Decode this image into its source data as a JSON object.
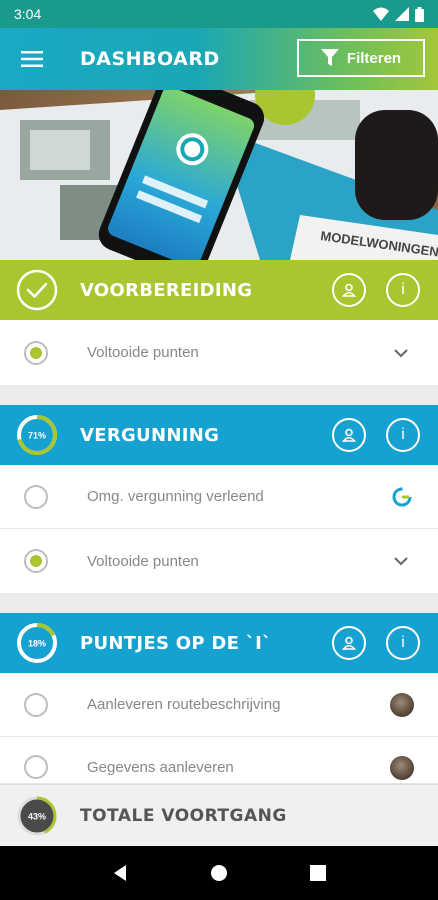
{
  "status": {
    "time": "3:04"
  },
  "appbar": {
    "title": "DASHBOARD",
    "filter_label": "Filteren"
  },
  "hero": {
    "sign_text": "MODELWONINGEN"
  },
  "sections": [
    {
      "title": "VOORBEREIDING",
      "color": "#a9c52f",
      "complete": true,
      "rows": [
        {
          "label": "Voltooide punten",
          "checked": true,
          "trailing": "chevron-down-icon"
        }
      ]
    },
    {
      "title": "VERGUNNING",
      "color": "#15a2d0",
      "progress_label": "71%",
      "progress": 0.71,
      "rows": [
        {
          "label": "Omg. vergunning verleend",
          "checked": false,
          "trailing": "brand-logo-icon"
        },
        {
          "label": "Voltooide punten",
          "checked": true,
          "trailing": "chevron-down-icon"
        }
      ]
    },
    {
      "title": "PUNTJES OP DE `I`",
      "color": "#15a2d0",
      "progress_label": "18%",
      "progress": 0.18,
      "rows": [
        {
          "label": "Aanleveren routebeschrijving",
          "checked": false,
          "trailing": "avatar"
        },
        {
          "label": "Gegevens aanleveren",
          "checked": false,
          "trailing": "avatar"
        }
      ]
    }
  ],
  "footer": {
    "title": "TOTALE VOORTGANG",
    "progress_label": "43%",
    "progress": 0.43
  },
  "colors": {
    "accent_green": "#a9c52f",
    "accent_blue": "#15a2d0"
  }
}
